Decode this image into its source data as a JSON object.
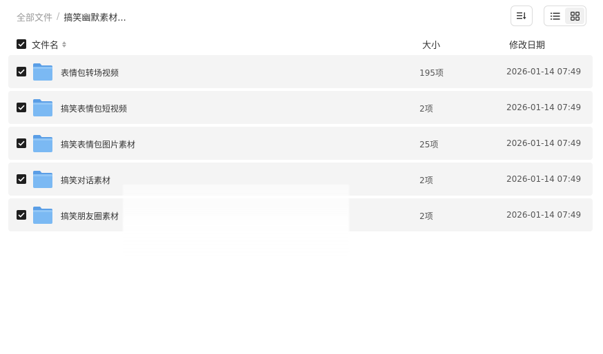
{
  "breadcrumb": {
    "root": "全部文件",
    "separator": "/",
    "current": "搞笑幽默素材..."
  },
  "toolbar": {
    "sort_icon": "sort-list-icon",
    "list_view_icon": "list-view-icon",
    "grid_view_icon": "grid-view-icon",
    "active_view": "list"
  },
  "table": {
    "headers": {
      "name": "文件名",
      "size": "大小",
      "modified": "修改日期"
    },
    "rows": [
      {
        "name": "表情包转场视频",
        "size": "195项",
        "modified": "2026-01-14 07:49",
        "checked": true,
        "icon": "folder-icon"
      },
      {
        "name": "搞笑表情包短视频",
        "size": "2项",
        "modified": "2026-01-14 07:49",
        "checked": true,
        "icon": "folder-icon"
      },
      {
        "name": "搞笑表情包图片素材",
        "size": "25项",
        "modified": "2026-01-14 07:49",
        "checked": true,
        "icon": "folder-icon"
      },
      {
        "name": "搞笑对话素材",
        "size": "2项",
        "modified": "2026-01-14 07:49",
        "checked": true,
        "icon": "folder-icon"
      },
      {
        "name": "搞笑朋友圈素材",
        "size": "2项",
        "modified": "2026-01-14 07:49",
        "checked": true,
        "icon": "folder-icon"
      }
    ]
  },
  "colors": {
    "row_background": "#f4f4f4",
    "checkbox": "#1f1f1f",
    "folder": "#64aaf0"
  }
}
